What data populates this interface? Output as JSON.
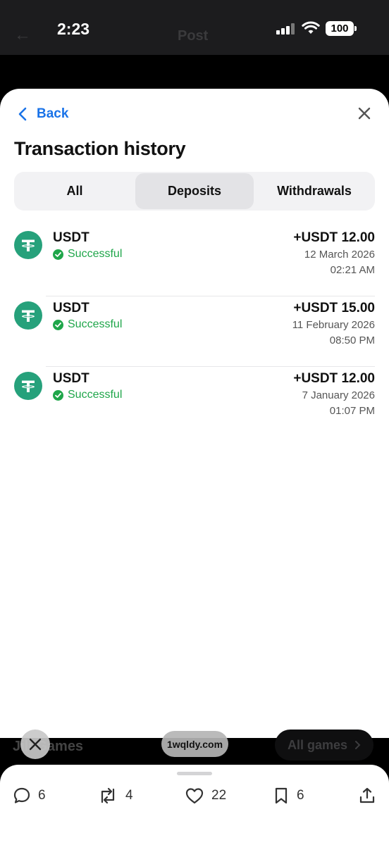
{
  "status_bar": {
    "time": "2:23",
    "battery": "100"
  },
  "background": {
    "page_title": "Post",
    "banner_left": "Jili Games",
    "banner_right": "All games"
  },
  "sheet": {
    "back_label": "Back",
    "title": "Transaction history",
    "tabs": [
      {
        "label": "All",
        "active": false
      },
      {
        "label": "Deposits",
        "active": true
      },
      {
        "label": "Withdrawals",
        "active": false
      }
    ],
    "transactions": [
      {
        "asset": "USDT",
        "status": "Successful",
        "amount": "+USDT 12.00",
        "date": "12 March 2026",
        "time": "02:21 AM",
        "icon": "tether-icon"
      },
      {
        "asset": "USDT",
        "status": "Successful",
        "amount": "+USDT 15.00",
        "date": "11 February 2026",
        "time": "08:50 PM",
        "icon": "tether-icon"
      },
      {
        "asset": "USDT",
        "status": "Successful",
        "amount": "+USDT 12.00",
        "date": "7 January 2026",
        "time": "01:07 PM",
        "icon": "tether-icon"
      }
    ]
  },
  "url_pill": "1wqldy.com",
  "actions": {
    "replies": "6",
    "reposts": "4",
    "likes": "22",
    "bookmarks": "6"
  },
  "colors": {
    "accent": "#1a73e8",
    "success": "#1fa64a",
    "tether": "#26a17b"
  }
}
